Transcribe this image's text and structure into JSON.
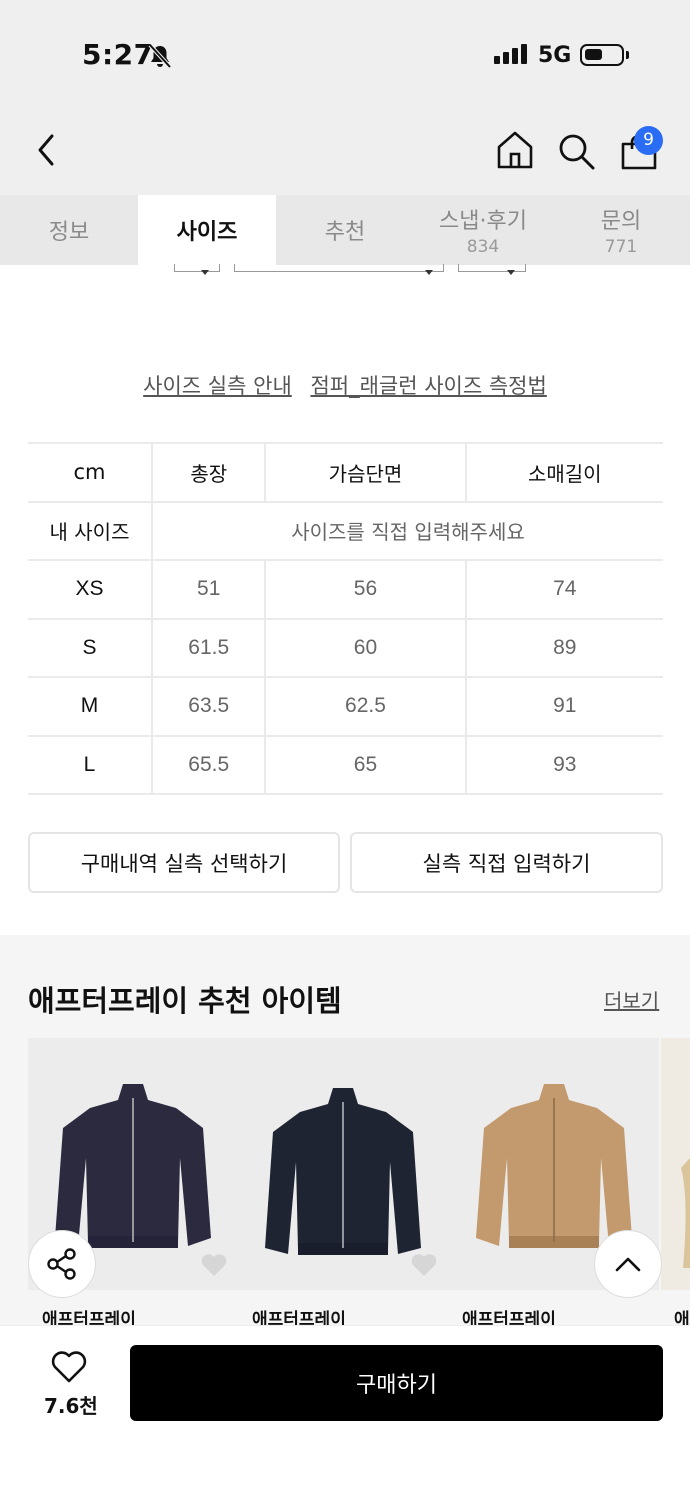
{
  "status_bar": {
    "time": "5:27",
    "network": "5G"
  },
  "nav": {
    "cart_count": "9"
  },
  "tabs": [
    {
      "label": "정보",
      "sub": ""
    },
    {
      "label": "사이즈",
      "sub": ""
    },
    {
      "label": "추천",
      "sub": ""
    },
    {
      "label": "스냅·후기",
      "sub": "834"
    },
    {
      "label": "문의",
      "sub": "771"
    }
  ],
  "active_tab": "사이즈",
  "links": {
    "guide": "사이즈 실측 안내",
    "method": "점퍼_래글런 사이즈 측정법"
  },
  "size_table": {
    "headers": [
      "cm",
      "총장",
      "가슴단면",
      "소매길이"
    ],
    "my_size_label": "내 사이즈",
    "my_size_prompt": "사이즈를 직접 입력해주세요",
    "rows": [
      {
        "size": "XS",
        "values": [
          "51",
          "56",
          "74"
        ]
      },
      {
        "size": "S",
        "values": [
          "61.5",
          "60",
          "89"
        ]
      },
      {
        "size": "M",
        "values": [
          "63.5",
          "62.5",
          "91"
        ]
      },
      {
        "size": "L",
        "values": [
          "65.5",
          "65",
          "93"
        ]
      }
    ]
  },
  "buttons": {
    "purchase_history": "구매내역 실측 선택하기",
    "direct_input": "실측 직접 입력하기"
  },
  "recommend": {
    "title": "애프터프레이 추천 아이템",
    "more": "더보기",
    "items": [
      {
        "brand": "애프터프레이",
        "color": "#2b2a3f"
      },
      {
        "brand": "애프터프레이",
        "color": "#1f2433"
      },
      {
        "brand": "애프터프레이",
        "color": "#c39a6d"
      },
      {
        "brand": "애",
        "color": "#d9c49c"
      }
    ]
  },
  "bottom_bar": {
    "like_count": "7.6천",
    "buy_label": "구매하기"
  }
}
